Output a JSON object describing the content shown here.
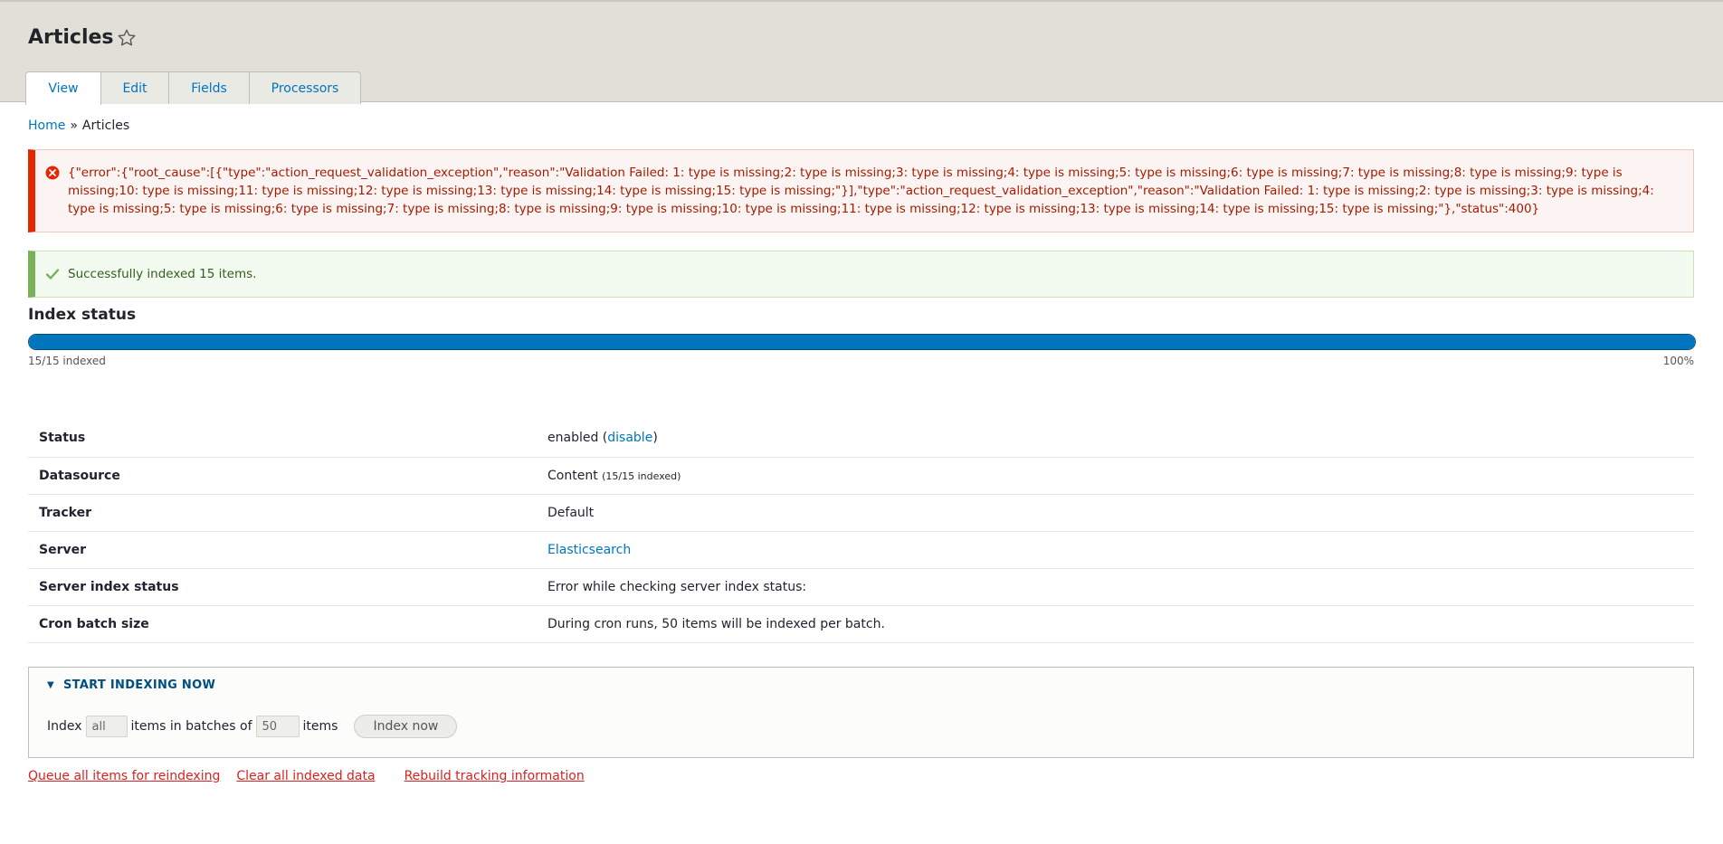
{
  "header": {
    "title": "Articles",
    "tabs": [
      {
        "label": "View",
        "active": true
      },
      {
        "label": "Edit"
      },
      {
        "label": "Fields"
      },
      {
        "label": "Processors"
      }
    ]
  },
  "breadcrumb": {
    "home": "Home",
    "separator": "»",
    "current": "Articles"
  },
  "messages": {
    "error": "{\"error\":{\"root_cause\":[{\"type\":\"action_request_validation_exception\",\"reason\":\"Validation Failed: 1: type is missing;2: type is missing;3: type is missing;4: type is missing;5: type is missing;6: type is missing;7: type is missing;8: type is missing;9: type is missing;10: type is missing;11: type is missing;12: type is missing;13: type is missing;14: type is missing;15: type is missing;\"}],\"type\":\"action_request_validation_exception\",\"reason\":\"Validation Failed: 1: type is missing;2: type is missing;3: type is missing;4: type is missing;5: type is missing;6: type is missing;7: type is missing;8: type is missing;9: type is missing;10: type is missing;11: type is missing;12: type is missing;13: type is missing;14: type is missing;15: type is missing;\"},\"status\":400}",
    "status": "Successfully indexed 15 items."
  },
  "index_status": {
    "title": "Index status",
    "progress_fraction": 1.0,
    "label": "15/15 indexed",
    "percent": "100%"
  },
  "info": {
    "status": {
      "label": "Status",
      "value_prefix": "enabled (",
      "link": "disable",
      "value_suffix": ")"
    },
    "datasource": {
      "label": "Datasource",
      "value": "Content",
      "small": "(15/15 indexed)"
    },
    "tracker": {
      "label": "Tracker",
      "value": "Default"
    },
    "server": {
      "label": "Server",
      "link": "Elasticsearch"
    },
    "server_index_status": {
      "label": "Server index status",
      "value": "Error while checking server index status:"
    },
    "cron_batch_size": {
      "label": "Cron batch size",
      "value": "During cron runs, 50 items will be indexed per batch."
    }
  },
  "indexing": {
    "summary": "Start indexing now",
    "triangle": "▼",
    "index_label": "Index",
    "limit_value": "all",
    "batches_label": "items in batches of",
    "batch_value": "50",
    "items_label": "items",
    "button": "Index now"
  },
  "actions": {
    "queue": "Queue all items for reindexing",
    "clear": "Clear all indexed data",
    "rebuild": "Rebuild tracking information"
  },
  "colors": {
    "accent": "#0074bd",
    "error": "#e62600",
    "success": "#77b259",
    "danger_link": "#d72222"
  }
}
